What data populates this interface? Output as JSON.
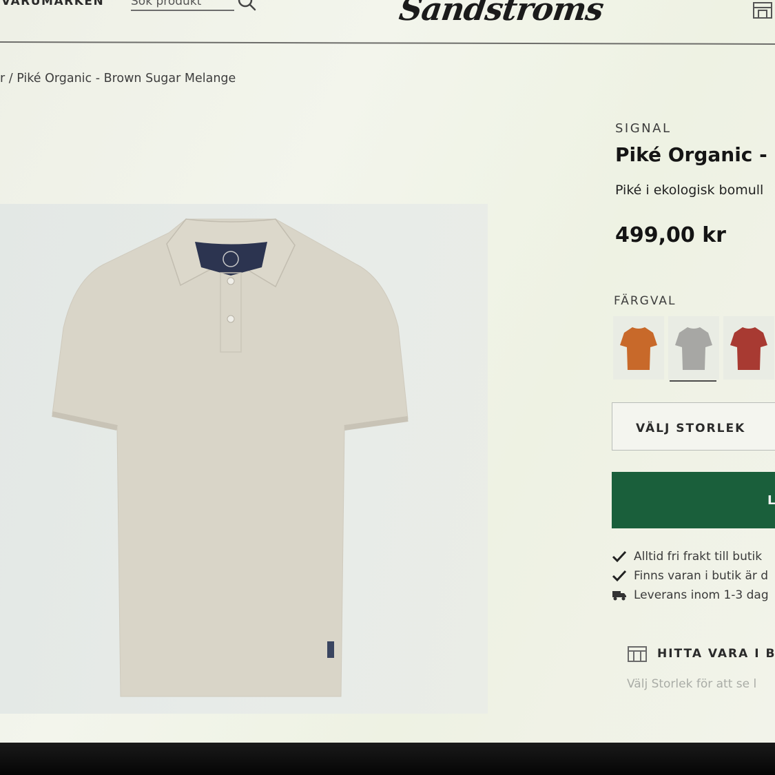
{
  "header": {
    "nav_brands": "VARUMÄRKEN",
    "search_placeholder": "Sök produkt",
    "logo": "Sandstroms"
  },
  "breadcrumb": {
    "trail": "r / Piké Organic - Brown Sugar Melange"
  },
  "product": {
    "brand": "SIGNAL",
    "title": "Piké Organic - B",
    "subtitle": "Piké i ekologisk bomull",
    "price": "499,00 kr",
    "image_icon": "polo-shirt-icon",
    "image_color": "#d8d3c6"
  },
  "colors": {
    "label": "FÄRGVAL",
    "swatches": [
      {
        "color": "#c8692a",
        "icon": "polo-shirt-icon",
        "selected": false
      },
      {
        "color": "#a7a7a4",
        "icon": "polo-shirt-icon",
        "selected": true
      },
      {
        "color": "#a83a32",
        "icon": "polo-shirt-icon",
        "selected": false
      }
    ]
  },
  "size": {
    "label": "VÄLJ STORLEK"
  },
  "buy": {
    "label": "L",
    "color": "#1a5f3b"
  },
  "usps": [
    {
      "icon": "check-icon",
      "text": "Alltid fri frakt till butik"
    },
    {
      "icon": "check-icon",
      "text": "Finns varan i butik är d"
    },
    {
      "icon": "truck-icon",
      "text": "Leverans inom 1-3 dag"
    }
  ],
  "find_store": {
    "label": "HITTA VARA I BU",
    "hint": "Välj Storlek för att se l",
    "icon": "store-icon"
  }
}
